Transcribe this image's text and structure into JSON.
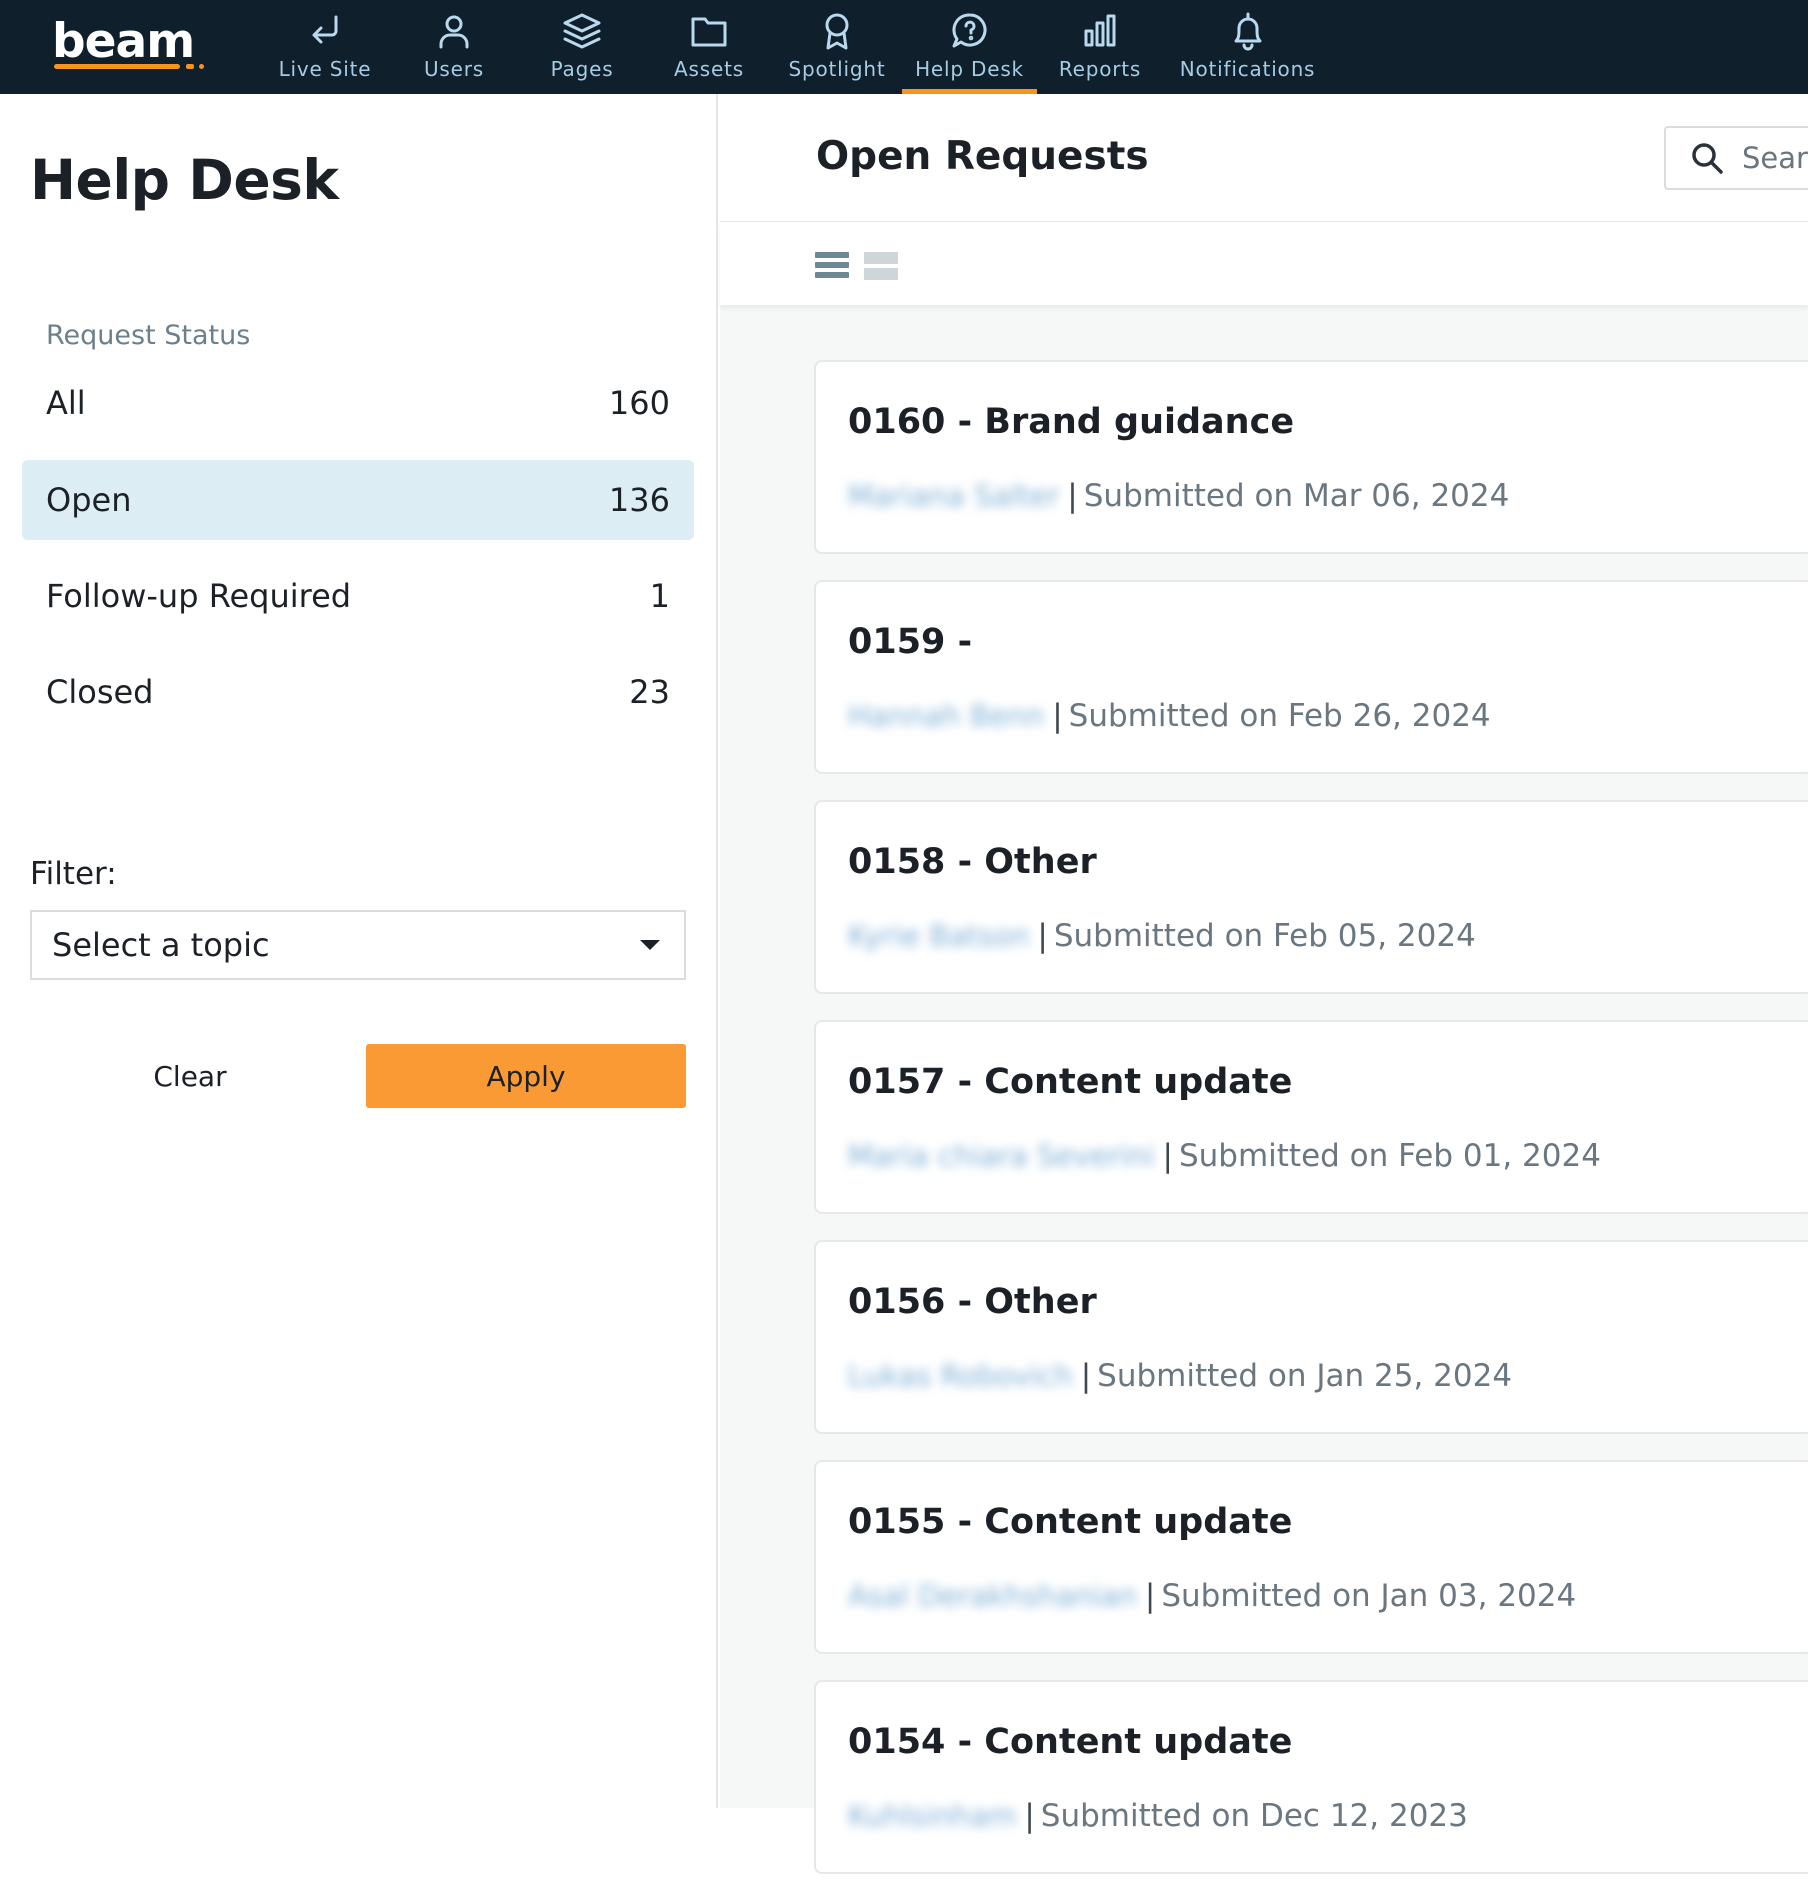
{
  "app": {
    "logo_text": "beam",
    "brand_color": "#f7941d",
    "nav_bg": "#0f1f2c"
  },
  "nav": {
    "items": [
      {
        "label": "Live Site",
        "icon": "return-arrow-icon"
      },
      {
        "label": "Users",
        "icon": "user-icon"
      },
      {
        "label": "Pages",
        "icon": "layers-icon"
      },
      {
        "label": "Assets",
        "icon": "folder-icon"
      },
      {
        "label": "Spotlight",
        "icon": "award-ribbon-icon"
      },
      {
        "label": "Help Desk",
        "icon": "help-bubble-icon",
        "active": true
      },
      {
        "label": "Reports",
        "icon": "bar-chart-icon"
      },
      {
        "label": "Notifications",
        "icon": "bell-icon"
      }
    ]
  },
  "sidebar": {
    "title": "Help Desk",
    "section_label": "Request Status",
    "statuses": [
      {
        "label": "All",
        "count": "160"
      },
      {
        "label": "Open",
        "count": "136",
        "active": true
      },
      {
        "label": "Follow-up Required",
        "count": "1"
      },
      {
        "label": "Closed",
        "count": "23"
      }
    ],
    "filter_label": "Filter:",
    "topic_select_value": "Select a topic",
    "clear_label": "Clear",
    "apply_label": "Apply"
  },
  "main": {
    "title": "Open Requests",
    "search_placeholder": "Search",
    "view_modes": [
      "list-view-icon",
      "card-view-icon"
    ],
    "requests": [
      {
        "title": "0160 - Brand guidance",
        "submitter": "Mariana Salter",
        "submitted": "Submitted on Mar 06, 2024"
      },
      {
        "title": "0159 -",
        "submitter": "Hannah Benn",
        "submitted": "Submitted on Feb 26, 2024"
      },
      {
        "title": "0158 - Other",
        "submitter": "Kyrie Batson",
        "submitted": "Submitted on Feb 05, 2024"
      },
      {
        "title": "0157 - Content update",
        "submitter": "Maria chiara Severini",
        "submitted": "Submitted on Feb 01, 2024"
      },
      {
        "title": "0156 - Other",
        "submitter": "Lukas Robovich",
        "submitted": "Submitted on Jan 25, 2024"
      },
      {
        "title": "0155 - Content update",
        "submitter": "Asal Derakhshanian",
        "submitted": "Submitted on Jan 03, 2024"
      },
      {
        "title": "0154 - Content update",
        "submitter": "Kuhlsinham",
        "submitted": "Submitted on Dec 12, 2023"
      }
    ]
  }
}
